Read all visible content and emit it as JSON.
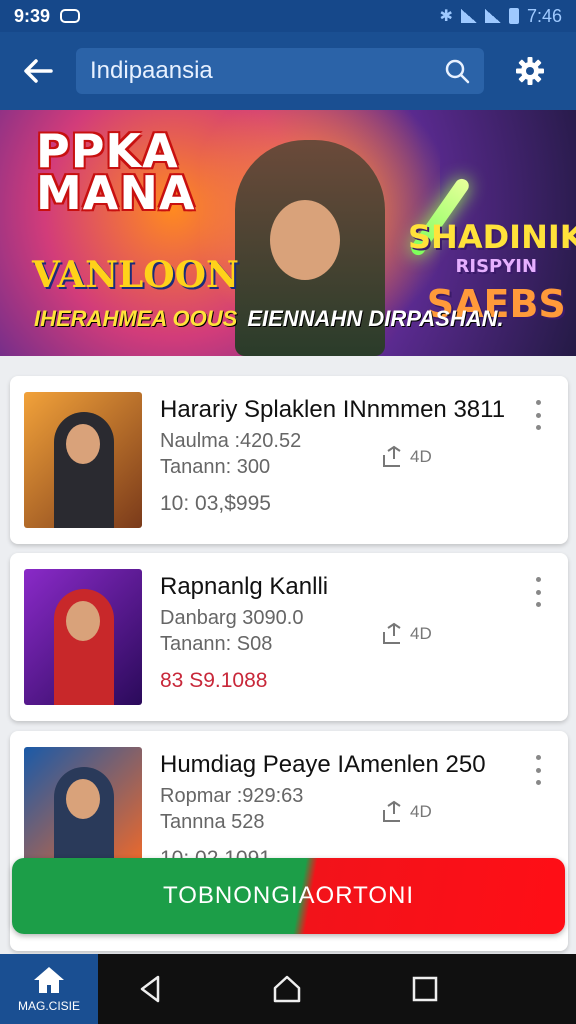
{
  "status": {
    "time": "9:39",
    "right_time": "7:46"
  },
  "header": {
    "search_value": "Indipaansia"
  },
  "banner": {
    "title_line1": "PPKA",
    "title_line2": "MANA",
    "logo_text": "VANLOON",
    "right_title": "SHADINIK",
    "right_sub": "RISPYIN",
    "right_big": "SAEBS",
    "caption_left": "IHERAHMEA OOUS",
    "caption_right": "EIENNAHN DIRPASHAN."
  },
  "items": [
    {
      "title": "Harariy Splaklen INnmmen 3811",
      "line1": "Naulma :420.52",
      "line2": "Tanann: 300",
      "price": "10: 03,$995",
      "share_label": "4D"
    },
    {
      "title": "Rapnanlg Kanlli",
      "line1": "Danbarg 3090.0",
      "line2": "Tanann: S08",
      "price": "83 S9.1088",
      "share_label": "4D"
    },
    {
      "title": "Humdiag Peaye IAmenlen 250",
      "line1": "Ropmar :929:63",
      "line2": "Tannna 528",
      "price": "10: 02.1091",
      "share_label": "4D"
    }
  ],
  "cta": {
    "label": "TOBNONGIAORTONI"
  },
  "nav": {
    "home_label": "MAG.CISIE"
  }
}
